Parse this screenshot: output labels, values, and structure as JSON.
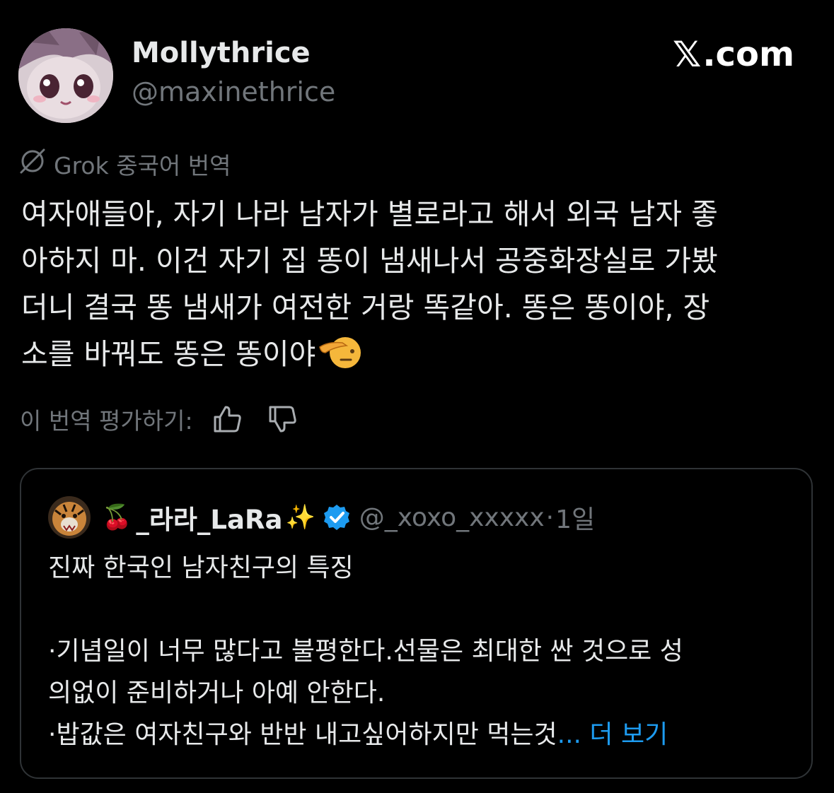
{
  "author": {
    "display_name": "Mollythrice",
    "handle": "@maxinethrice"
  },
  "brand": {
    "x_glyph": "𝕏",
    "domain_suffix": ".com"
  },
  "translation": {
    "label": "Grok 중국어 번역",
    "icon": "grok-icon"
  },
  "tweet": {
    "lines": [
      "여자애들아, 자기 나라 남자가 별로라고 해서 외국 남자 좋",
      "아하지 마. 이건 자기 집 똥이 냄새나서 공중화장실로 가봤",
      "더니 결국 똥 냄새가 여전한 거랑 똑같아. 똥은 똥이야, 장",
      "소를 바꿔도 똥은 똥이야"
    ],
    "emoji": "saluting-face"
  },
  "rating": {
    "label": "이 번역 평가하기:",
    "like_icon": "thumbs-up-icon",
    "dislike_icon": "thumbs-down-icon"
  },
  "quote": {
    "name_prefix_emoji": "🍒",
    "name": "_라라_LaRa",
    "name_suffix_emoji": "✨",
    "verified": true,
    "handle": "@_xoxo_xxxxx",
    "separator": "·",
    "time": "1일",
    "lines": [
      "진짜 한국인 남자친구의 특징",
      "",
      "·기념일이 너무 많다고 불평한다.선물은 최대한 싼 것으로 성",
      "의없이 준비하거나 아예 안한다.",
      "·밥값은 여자친구와 반반 내고싶어하지만 먹는것"
    ],
    "more_ellipsis": "...",
    "more_label": " 더 보기"
  },
  "colors": {
    "background": "#000000",
    "text": "#e7e9ea",
    "muted": "#71767b",
    "border": "#2f3336",
    "link": "#1d9bf0"
  }
}
